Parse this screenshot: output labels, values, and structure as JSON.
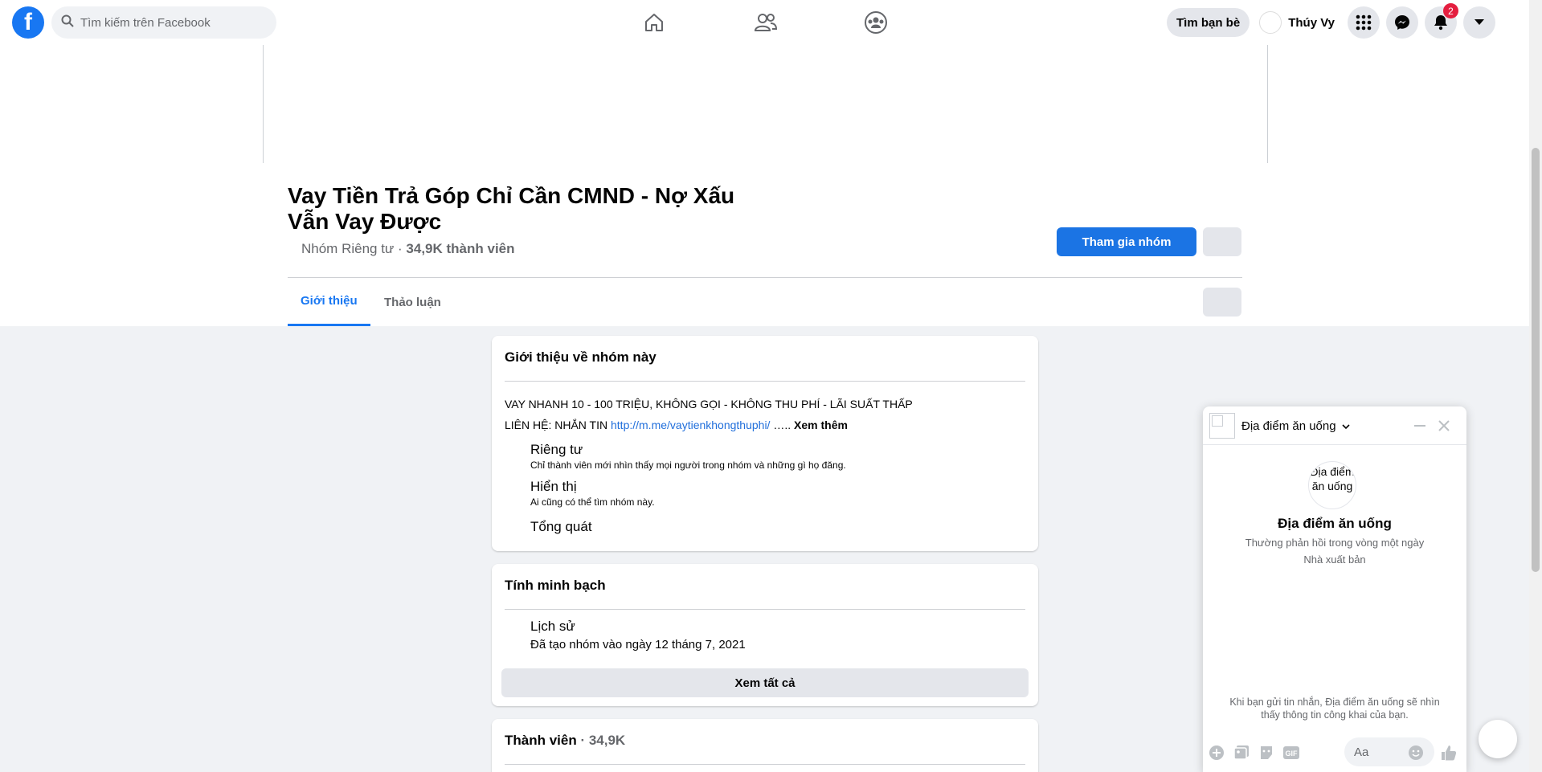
{
  "topbar": {
    "search_placeholder": "Tìm kiếm trên Facebook",
    "find_friends": "Tìm bạn bè",
    "profile_name": "Thúy Vy",
    "notif_count": "2"
  },
  "group": {
    "title_line1": "Vay Tiền Trả Góp Chỉ Cần CMND - Nợ Xấu",
    "title_line2": "Vẫn Vay Được",
    "privacy": "Nhóm Riêng tư · ",
    "members": "34,9K thành viên",
    "join_label": "Tham gia nhóm"
  },
  "tabs": [
    {
      "label": "Giới thiệu"
    },
    {
      "label": "Thảo luận"
    }
  ],
  "about": {
    "title": "Giới thiệu về nhóm này",
    "desc_line1": "VAY NHANH 10 - 100 TRIỆU, KHÔNG GỌI - KHÔNG THU PHÍ - LÃI SUẤT THẤP",
    "desc_line2_prefix": "LIÊN HỆ: NHẮN TIN ",
    "desc_link": "http://m.me/vaytienkhongthuphi/",
    "desc_ellipsis": " ….. ",
    "see_more": "Xem thêm",
    "private_title": "Riêng tư",
    "private_desc": "Chỉ thành viên mới nhìn thấy mọi người trong nhóm và những gì họ đăng.",
    "visible_title": "Hiển thị",
    "visible_desc": "Ai cũng có thể tìm nhóm này.",
    "general_title": "Tổng quát"
  },
  "transparency": {
    "title": "Tính minh bạch",
    "history_title": "Lịch sử",
    "history_desc": "Đã tạo nhóm vào ngày 12 tháng 7, 2021",
    "see_all": "Xem tất cả"
  },
  "members_card": {
    "title": "Thành viên",
    "count": " · 34,9K"
  },
  "chat": {
    "title": "Địa điểm ăn uống",
    "avatar_alt": "Địa điểm ăn uống",
    "name": "Địa điểm ăn uống",
    "response": "Thường phản hồi trong vòng một ngày",
    "role": "Nhà xuất bản",
    "note": "Khi bạn gửi tin nhắn, Địa điểm ăn uống sẽ nhìn thấy thông tin công khai của bạn.",
    "input_placeholder": "Aa"
  },
  "colors": {
    "brand": "#1877f2",
    "join_button": "#1b74e4",
    "badge": "#e41e3f",
    "background": "#f0f2f5"
  }
}
